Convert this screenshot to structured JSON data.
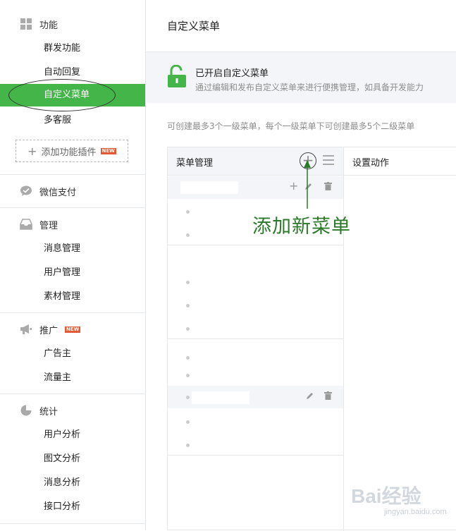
{
  "sidebar": {
    "function": {
      "title": "功能",
      "items": [
        "群发功能",
        "自动回复",
        "自定义菜单",
        "多客服"
      ],
      "active_index": 2,
      "add_plugin": "添加功能插件",
      "add_plugin_badge": "NEW"
    },
    "wechat_pay": {
      "title": "微信支付"
    },
    "manage": {
      "title": "管理",
      "items": [
        "消息管理",
        "用户管理",
        "素材管理"
      ]
    },
    "promote": {
      "title": "推广",
      "badge": "NEW",
      "items": [
        "广告主",
        "流量主"
      ]
    },
    "stats": {
      "title": "统计",
      "items": [
        "用户分析",
        "图文分析",
        "消息分析",
        "接口分析"
      ]
    }
  },
  "main": {
    "title": "自定义菜单",
    "banner": {
      "title": "已开启自定义菜单",
      "desc": "通过编辑和发布自定义菜单来进行便携管理，如具备开发能力"
    },
    "hint": "可创建最多3个一级菜单，每个一级菜单下可创建最多5个二级菜单",
    "panel": {
      "menu_header": "菜单管理",
      "action_header": "设置动作"
    }
  },
  "annotation": {
    "text": "添加新菜单"
  },
  "watermark": {
    "text": "Bai经验",
    "sub": "jingyan.baidu.com"
  },
  "colors": {
    "accent": "#44b549",
    "annotation": "#2b7a2a",
    "badge": "#e25b34"
  },
  "icons": {
    "function": "grid-icon",
    "pay": "chat-bubble-icon",
    "manage": "inbox-icon",
    "promote": "megaphone-icon",
    "stats": "pie-chart-icon",
    "lock": "unlock-icon",
    "add": "plus-circle-icon",
    "sort": "list-icon",
    "edit": "pencil-icon",
    "delete": "trash-icon"
  }
}
